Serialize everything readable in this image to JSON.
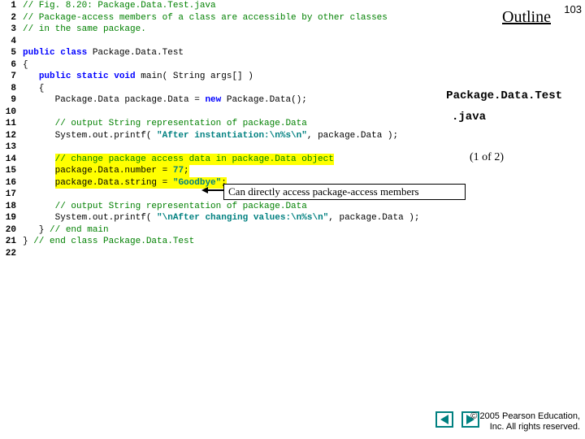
{
  "page_number": "103",
  "outline": "Outline",
  "labels": {
    "classname": "Package.Data.Test",
    "ext": ".java",
    "part": "(1 of 2)"
  },
  "callout": "Can directly access package-access members",
  "footer": {
    "l1": "© 2005 Pearson Education,",
    "l2": "Inc.  All rights reserved."
  },
  "code": {
    "l1": {
      "n": "1",
      "a": "// Fig. 8.20: Package.Data.Test.java"
    },
    "l2": {
      "n": "2",
      "a": "// Package-access members of a class are accessible by other classes"
    },
    "l3": {
      "n": "3",
      "a": "// in the same package."
    },
    "l4": {
      "n": "4",
      "a": ""
    },
    "l5": {
      "n": "5",
      "a": "public class",
      "b": " Package.Data.Test"
    },
    "l6": {
      "n": "6",
      "a": "{"
    },
    "l7": {
      "n": "7",
      "a": "   ",
      "b": "public static void",
      "c": " main( String args[] )"
    },
    "l8": {
      "n": "8",
      "a": "   {"
    },
    "l9": {
      "n": "9",
      "a": "      Package.Data package.Data = ",
      "b": "new",
      "c": " Package.Data();"
    },
    "l10": {
      "n": "10",
      "a": ""
    },
    "l11": {
      "n": "11",
      "a": "      ",
      "b": "// output String representation of package.Data"
    },
    "l12": {
      "n": "12",
      "a": "      System.out.printf( ",
      "b": "\"After instantiation:\\n%s\\n\"",
      "c": ", package.Data );"
    },
    "l13": {
      "n": "13",
      "a": ""
    },
    "l14": {
      "n": "14",
      "a": "      ",
      "b": "// change package access data in package.Data object"
    },
    "l15": {
      "n": "15",
      "a": "      ",
      "b": "package.Data.number = ",
      "c": "77",
      "d": ";"
    },
    "l16": {
      "n": "16",
      "a": "      ",
      "b": "package.Data.string = ",
      "c": "\"Goodbye\"",
      "d": ";"
    },
    "l17": {
      "n": "17",
      "a": ""
    },
    "l18": {
      "n": "18",
      "a": "      ",
      "b": "// output String representation of package.Data"
    },
    "l19": {
      "n": "19",
      "a": "      System.out.printf( ",
      "b": "\"\\nAfter changing values:\\n%s\\n\"",
      "c": ", package.Data );"
    },
    "l20": {
      "n": "20",
      "a": "   } ",
      "b": "// end main"
    },
    "l21": {
      "n": "21",
      "a": "} ",
      "b": "// end class Package.Data.Test"
    },
    "l22": {
      "n": "22",
      "a": ""
    }
  }
}
